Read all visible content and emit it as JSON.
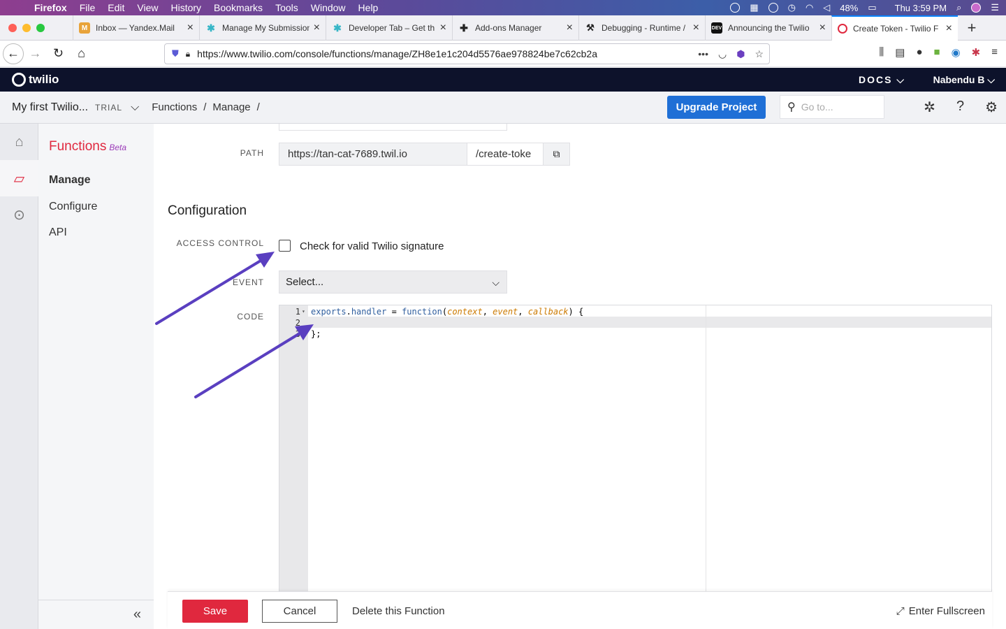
{
  "mac_menu": {
    "app": "Firefox",
    "items": [
      "File",
      "Edit",
      "View",
      "History",
      "Bookmarks",
      "Tools",
      "Window",
      "Help"
    ],
    "battery": "48%",
    "clock": "Thu 3:59 PM"
  },
  "tabs": [
    {
      "label": "Inbox — Yandex.Mail",
      "icon": "mail-icon",
      "color": "#e8a33a"
    },
    {
      "label": "Manage My Submission",
      "icon": "puzzle-icon",
      "color": "#37b6c7"
    },
    {
      "label": "Developer Tab – Get th",
      "icon": "puzzle-icon",
      "color": "#37b6c7"
    },
    {
      "label": "Add-ons Manager",
      "icon": "addon-icon",
      "color": "#222222"
    },
    {
      "label": "Debugging - Runtime /",
      "icon": "wrench-icon",
      "color": "#222222"
    },
    {
      "label": "Announcing the Twilio",
      "icon": "dev-icon",
      "color": "#111111"
    },
    {
      "label": "Create Token - Twilio F",
      "icon": "twilio-icon",
      "color": "#e0283e"
    }
  ],
  "url": "https://www.twilio.com/console/functions/manage/ZH8e1e1c204d5576ae978824be7c62cb2a",
  "tw_header": {
    "logo": "twilio",
    "docs": "DOCS",
    "user": "Nabendu B"
  },
  "subbar": {
    "project": "My first Twilio...",
    "trial": "TRIAL",
    "crumb1": "Functions",
    "sep": "/",
    "crumb2": "Manage",
    "sep2": "/",
    "upgrade": "Upgrade Project",
    "search_placeholder": "Go to..."
  },
  "leftnav": {
    "title": "Functions",
    "beta": "Beta",
    "items": [
      "Manage",
      "Configure",
      "API"
    ]
  },
  "form": {
    "path_label": "PATH",
    "path_host": "https://tan-cat-7689.twil.io",
    "path_value": "/create-toke",
    "section": "Configuration",
    "access_label": "ACCESS CONTROL",
    "access_checkbox": "Check for valid Twilio signature",
    "event_label": "EVENT",
    "event_value": "Select...",
    "code_label": "CODE"
  },
  "code": {
    "line_numbers": [
      "1",
      "2",
      "3"
    ],
    "line1_a": "exports",
    "line1_b": ".",
    "line1_c": "handler",
    "line1_d": " = ",
    "line1_e": "function",
    "line1_f": "(",
    "line1_g": "context",
    "line1_h": ", ",
    "line1_i": "event",
    "line1_j": ", ",
    "line1_k": "callback",
    "line1_l": ") {",
    "line3": "};"
  },
  "footer": {
    "save": "Save",
    "cancel": "Cancel",
    "delete": "Delete this Function",
    "fullscreen": "Enter Fullscreen"
  },
  "annotation_color": "#5a3fc0"
}
